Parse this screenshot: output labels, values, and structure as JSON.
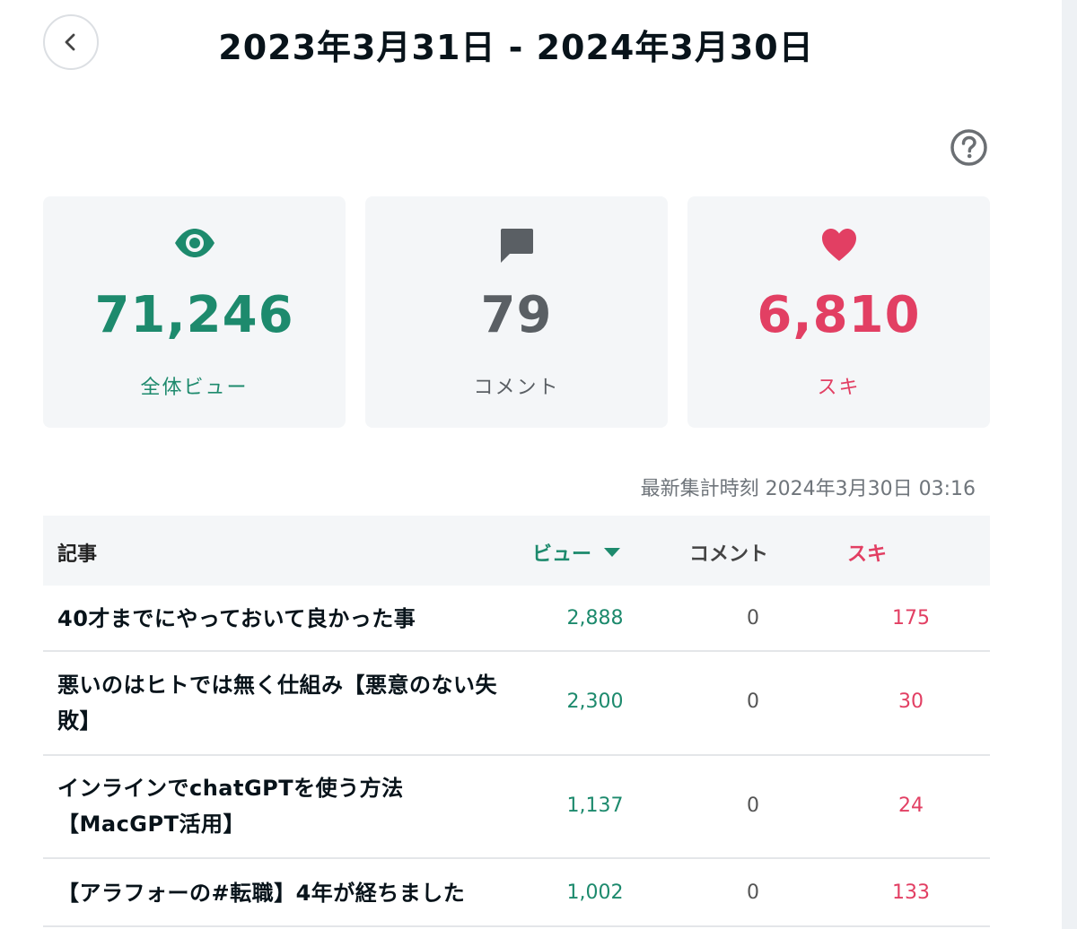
{
  "header": {
    "back_label": "戻る",
    "title": "2023年3月31日 - 2024年3月30日"
  },
  "help": {
    "icon": "question-circle-icon"
  },
  "stats": {
    "views": {
      "value": "71,246",
      "label": "全体ビュー",
      "icon": "eye-icon",
      "color": "#1d8a6d"
    },
    "comments": {
      "value": "79",
      "label": "コメント",
      "icon": "comment-icon",
      "color": "#5a5f64"
    },
    "likes": {
      "value": "6,810",
      "label": "スキ",
      "icon": "heart-icon",
      "color": "#e23f63"
    }
  },
  "updated_at": "最新集計時刻 2024年3月30日 03:16",
  "table": {
    "headers": {
      "article": "記事",
      "views": "ビュー",
      "comments": "コメント",
      "likes": "スキ"
    },
    "rows": [
      {
        "title": "40才までにやっておいて良かった事",
        "views": "2,888",
        "comments": "0",
        "likes": "175"
      },
      {
        "title": "悪いのはヒトでは無く仕組み【悪意のない失敗】",
        "views": "2,300",
        "comments": "0",
        "likes": "30"
      },
      {
        "title": "インラインでchatGPTを使う方法【MacGPT活用】",
        "views": "1,137",
        "comments": "0",
        "likes": "24"
      },
      {
        "title": "【アラフォーの#転職】4年が経ちました",
        "views": "1,002",
        "comments": "0",
        "likes": "133"
      }
    ]
  }
}
